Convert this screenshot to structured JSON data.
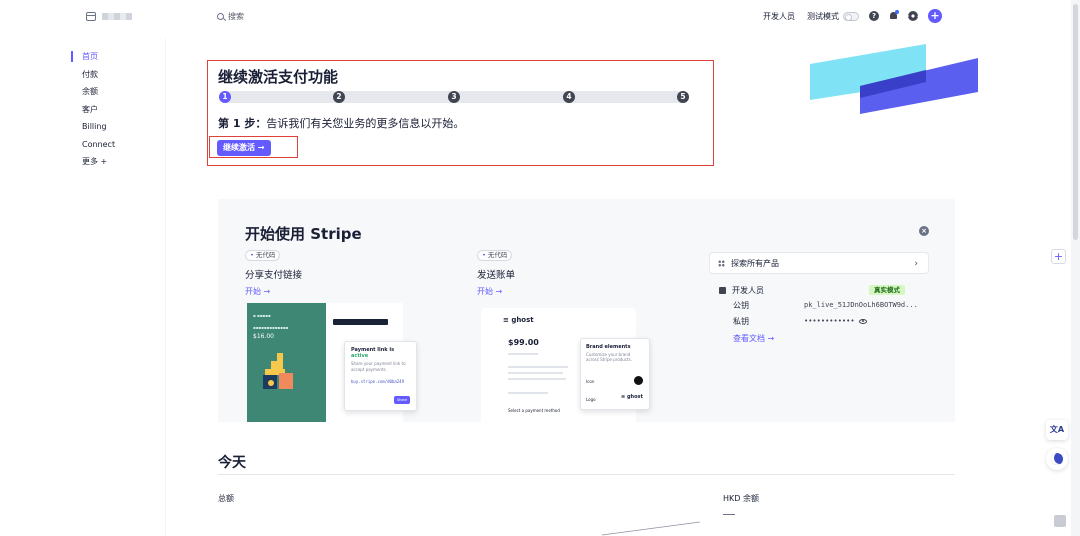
{
  "header": {
    "search_placeholder": "搜索",
    "developers": "开发人员",
    "test_mode": "测试模式",
    "help_icon_glyph": "?"
  },
  "sidebar": {
    "items": [
      {
        "label": "首页",
        "active": true
      },
      {
        "label": "付款"
      },
      {
        "label": "余额"
      },
      {
        "label": "客户"
      },
      {
        "label": "Billing"
      },
      {
        "label": "Connect"
      },
      {
        "label": "更多 +"
      }
    ]
  },
  "activation": {
    "title": "继续激活支付功能",
    "steps": [
      "1",
      "2",
      "3",
      "4",
      "5"
    ],
    "step_prefix": "第 1 步：",
    "step_text": "告诉我们有关您业务的更多信息以开始。",
    "continue_button": "继续激活 →"
  },
  "get_started": {
    "title": "开始使用 Stripe",
    "features": [
      {
        "badge": "无代码",
        "title": "分享支付链接",
        "link": "开始 →"
      },
      {
        "badge": "无代码",
        "title": "发送账单",
        "link": "开始 →"
      }
    ],
    "mock_payment_link": {
      "price": "$16.00",
      "title": "Payment link is",
      "status": "active",
      "subtitle": "Share your payment link to accept payments.",
      "url": "buy.stripe.com/d0ba249",
      "share": "Share"
    },
    "mock_invoice": {
      "brand": "ghost",
      "price": "$99.00",
      "card_title": "Brand elements",
      "card_sub": "Customize your brand across Stripe products.",
      "icon_label": "Icon",
      "logo_label": "Logo",
      "payment_method": "Select a payment method"
    },
    "explore_products": "探索所有产品",
    "developers_label": "开发人员",
    "live_mode": "真实模式",
    "publishable_key_label": "公钥",
    "publishable_key_value": "pk_live_51JDnOoLh6BOTW9d...",
    "secret_key_label": "私钥",
    "secret_key_value": "••••••••••••",
    "docs_link": "查看文档 →"
  },
  "today": {
    "title": "今天",
    "total_label": "总额",
    "hkd_balance_label": "HKD 余额",
    "hkd_balance_value": "—"
  },
  "right_rail": {
    "translate_label": "文A"
  },
  "colors": {
    "accent": "#635bff",
    "annotation_red": "#e0413a",
    "live_badge_bg": "#d7f7c2",
    "deco_cyan": "#7fe3f5",
    "deco_blue": "#5a5ff0"
  },
  "icons": [
    "brand-icon",
    "search-icon",
    "help-icon",
    "bell-icon",
    "gear-icon",
    "plus-icon",
    "close-icon",
    "grid-icon",
    "chevron-right-icon",
    "code-icon",
    "eye-icon",
    "translate-icon",
    "bot-icon"
  ]
}
